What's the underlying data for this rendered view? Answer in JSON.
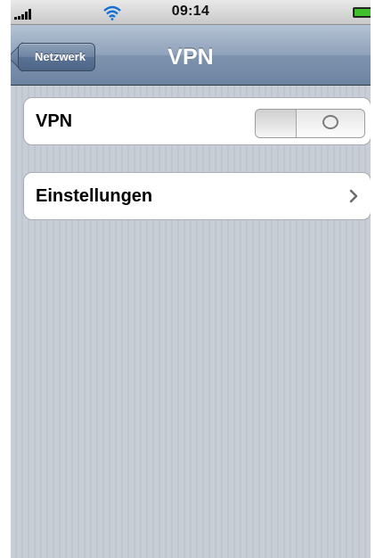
{
  "status_bar": {
    "time": "09:14",
    "icons": [
      "signal-icon",
      "wifi-icon",
      "battery-icon"
    ],
    "battery_color": "#3fbf2c"
  },
  "nav": {
    "back_label": "Netzwerk",
    "title": "VPN"
  },
  "settings": {
    "vpn_label": "VPN",
    "vpn_enabled": false,
    "settings_label": "Einstellungen",
    "chevron_icon": "chevron-right-icon"
  },
  "colors": {
    "nav_bar": "#7e93ae",
    "background": "#c5ccd4"
  }
}
